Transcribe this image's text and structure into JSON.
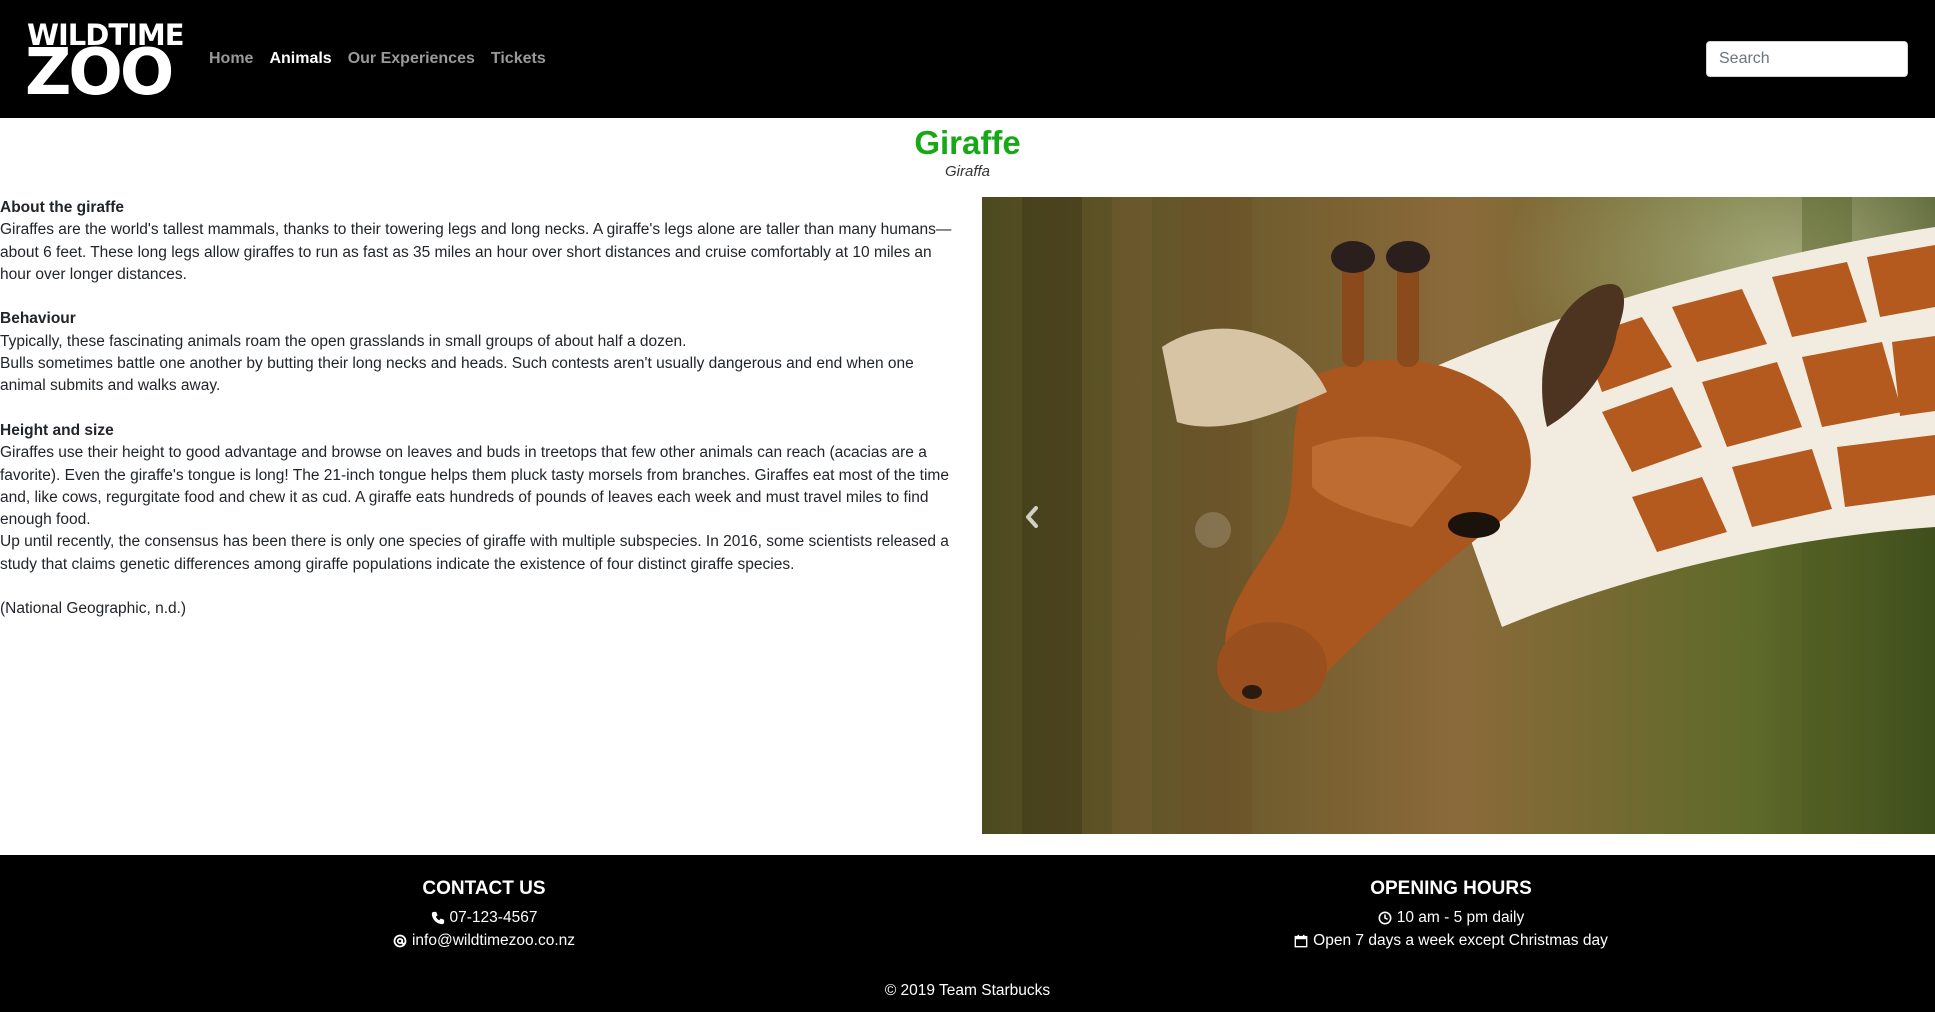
{
  "header": {
    "logo_top": "WILDTIME",
    "logo_bottom": "ZOO",
    "nav": [
      {
        "label": "Home",
        "active": false
      },
      {
        "label": "Animals",
        "active": true
      },
      {
        "label": "Our Experiences",
        "active": false
      },
      {
        "label": "Tickets",
        "active": false
      }
    ],
    "search_placeholder": "Search"
  },
  "animal": {
    "name": "Giraffe",
    "scientific_name": "Giraffa",
    "sections": [
      {
        "heading": "About the giraffe",
        "paragraphs": [
          "Giraffes are the world's tallest mammals, thanks to their towering legs and long necks. A giraffe's legs alone are taller than many humans—about 6 feet. These long legs allow giraffes to run as fast as 35 miles an hour over short distances and cruise comfortably at 10 miles an hour over longer distances."
        ]
      },
      {
        "heading": "Behaviour",
        "paragraphs": [
          "Typically, these fascinating animals roam the open grasslands in small groups of about half a dozen.",
          "Bulls sometimes battle one another by butting their long necks and heads. Such contests aren't usually dangerous and end when one animal submits and walks away."
        ]
      },
      {
        "heading": "Height and size",
        "paragraphs": [
          "Giraffes use their height to good advantage and browse on leaves and buds in treetops that few other animals can reach (acacias are a favorite). Even the giraffe's tongue is long! The 21-inch tongue helps them pluck tasty morsels from branches. Giraffes eat most of the time and, like cows, regurgitate food and chew it as cud. A giraffe eats hundreds of pounds of leaves each week and must travel miles to find enough food.",
          "Up until recently, the consensus has been there is only one species of giraffe with multiple subspecies. In 2016, some scientists released a study that claims genetic differences among giraffe populations indicate the existence of four distinct giraffe species."
        ]
      }
    ],
    "citation": "(National Geographic, n.d.)"
  },
  "carousel": {
    "prev_icon": "chevron-left-icon"
  },
  "footer": {
    "contact_title": "CONTACT US",
    "phone": "07-123-4567",
    "email": "info@wildtimezoo.co.nz",
    "hours_title": "OPENING HOURS",
    "hours": "10 am - 5 pm daily",
    "days": "Open 7 days a week except Christmas day",
    "copyright": "© 2019 Team Starbucks"
  },
  "colors": {
    "title_green": "#17a817",
    "nav_inactive": "#9a9a9a",
    "nav_active": "#ffffff",
    "header_bg": "#000000"
  }
}
